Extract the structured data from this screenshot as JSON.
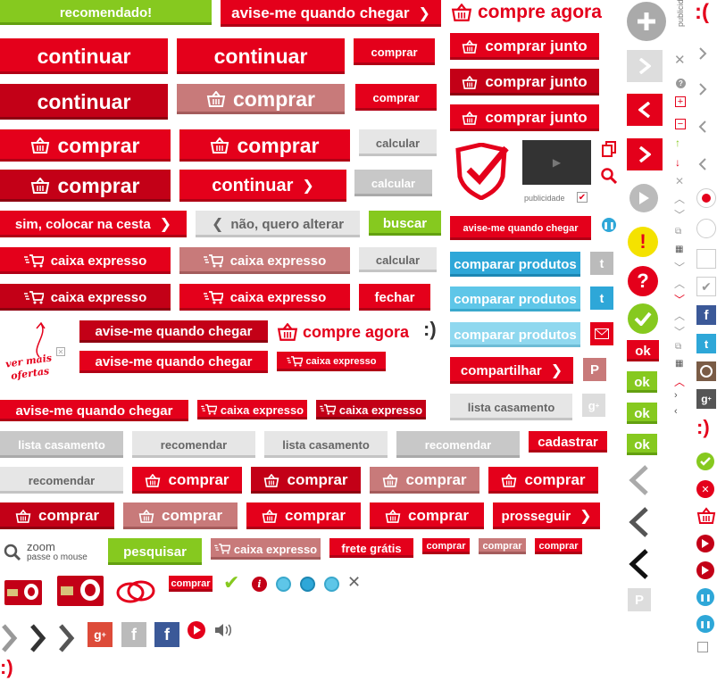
{
  "labels": {
    "recomendado": "recomendado!",
    "avise_me": "avise-me quando chegar",
    "compre_agora": "compre agora",
    "continuar": "continuar",
    "comprar": "comprar",
    "comprar_junto": "comprar junto",
    "calcular": "calcular",
    "sim_colocar": "sim, colocar na cesta",
    "nao_alterar": "não, quero alterar",
    "buscar": "buscar",
    "caixa_expresso": "caixa expresso",
    "fechar": "fechar",
    "comparar_produtos": "comparar produtos",
    "compartilhar": "compartilhar",
    "lista_casamento": "lista casamento",
    "recomendar": "recomendar",
    "cadastrar": "cadastrar",
    "prosseguir": "prosseguir",
    "pesquisar": "pesquisar",
    "frete_gratis": "frete grátis",
    "ok": "ok",
    "publicidade": "publicidade",
    "zoom": "zoom",
    "passe_o_mouse": "passe o mouse",
    "ver_mais_ofertas_1": "ver mais",
    "ver_mais_ofertas_2": "ofertas",
    "smile": ":)",
    "sad": ":("
  },
  "colors": {
    "red": "#e4001b",
    "dark_red": "#c30017",
    "muted_red": "#c87a7a",
    "green": "#86c91f",
    "blue": "#2ea7d8",
    "gray": "#e6e6e6"
  },
  "icons": [
    "basket-icon",
    "express-cart-icon",
    "chevron-right-icon",
    "chevron-left-icon",
    "plus-circle-icon",
    "close-icon",
    "help-icon",
    "play-icon",
    "pause-icon",
    "alert-icon",
    "check-icon",
    "twitter-icon",
    "facebook-icon",
    "googleplus-icon",
    "pinterest-icon",
    "instagram-icon",
    "mail-icon",
    "zoom-icon",
    "copy-icon",
    "search-icon",
    "shield-check-icon",
    "wedding-rings-icon",
    "credit-card-icon",
    "speaker-icon",
    "info-icon"
  ]
}
